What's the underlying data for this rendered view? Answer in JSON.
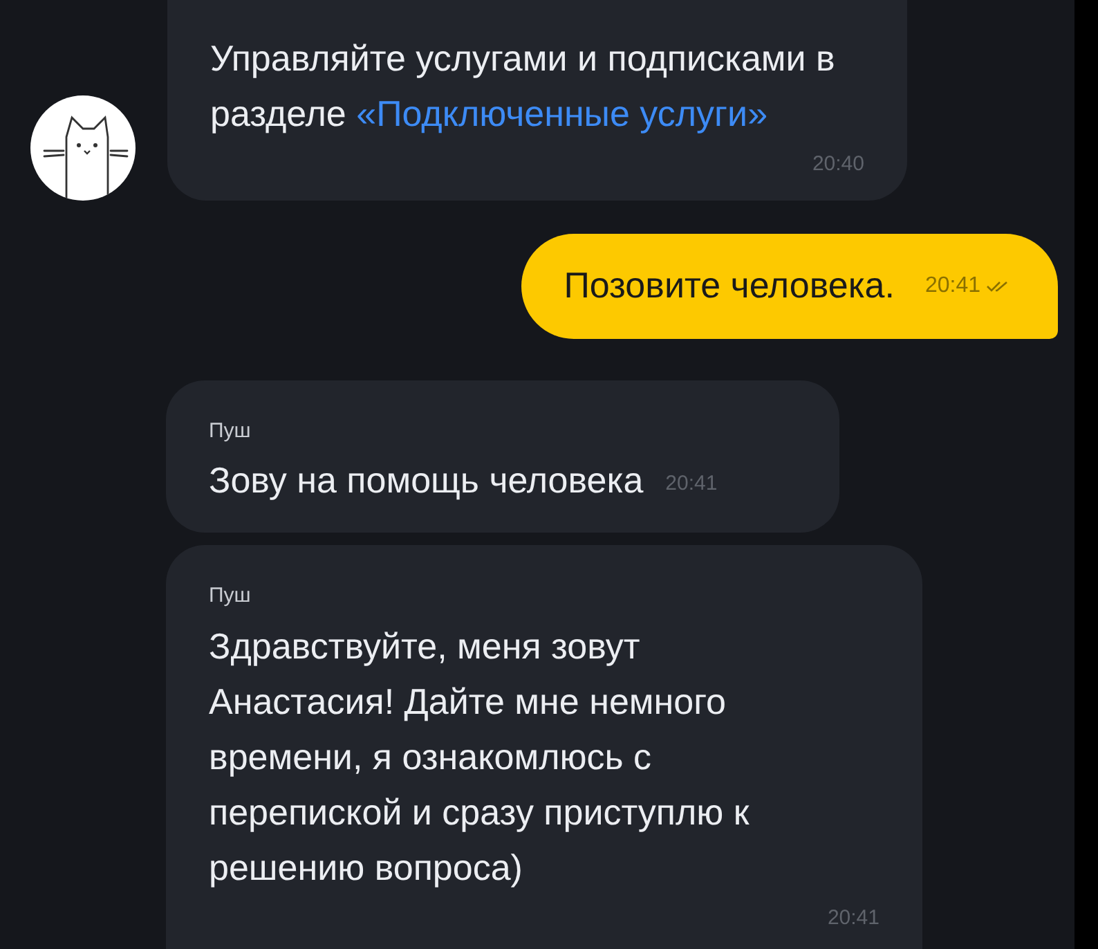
{
  "messages": [
    {
      "kind": "incoming",
      "text": "Управляйте услугами и подписками в разделе ",
      "link": "«Подключенные услуги»",
      "time": "20:40",
      "avatar": true
    },
    {
      "kind": "outgoing",
      "text": "Позовите человека.",
      "time": "20:41",
      "read": true
    },
    {
      "kind": "incoming",
      "sender": "Пуш",
      "text": "Зову на помощь человека",
      "time": "20:41",
      "inline_time": true
    },
    {
      "kind": "incoming",
      "sender": "Пуш",
      "text": "Здравствуйте, меня зовут Анастасия! Дайте мне немного времени, я ознакомлюсь с перепиской и сразу приступлю к решению вопроса)",
      "time": "20:41"
    }
  ]
}
